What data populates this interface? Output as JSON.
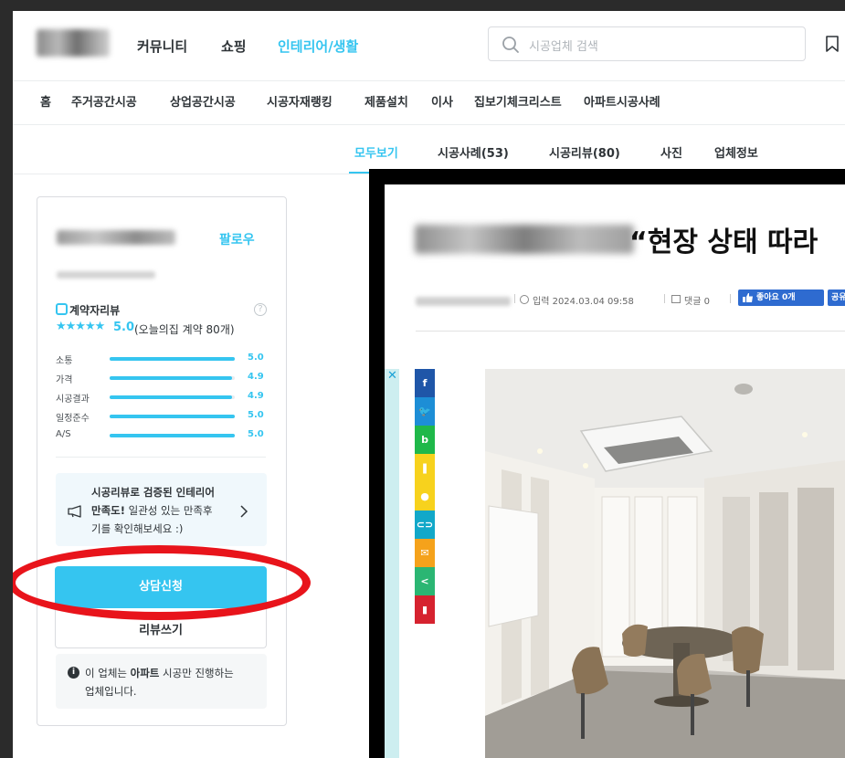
{
  "nav": {
    "items": [
      {
        "label": "커뮤니티",
        "active": false
      },
      {
        "label": "쇼핑",
        "active": false
      },
      {
        "label": "인테리어/생활",
        "active": true
      }
    ],
    "search_placeholder": "시공업체 검색"
  },
  "categories": [
    "홈",
    "주거공간시공",
    "상업공간시공",
    "시공자재랭킹",
    "제품설치",
    "이사",
    "집보기체크리스트",
    "아파트시공사례"
  ],
  "tabs": [
    {
      "label": "모두보기",
      "active": true
    },
    {
      "label": "시공사례(53)",
      "active": false
    },
    {
      "label": "시공리뷰(80)",
      "active": false
    },
    {
      "label": "사진",
      "active": false
    },
    {
      "label": "업체정보",
      "active": false
    }
  ],
  "vendor": {
    "follow_label": "팔로우",
    "review_title": "계약자리뷰",
    "stars": "★★★★★",
    "score": "5.0",
    "score_note": "(오늘의집 계약 80개)",
    "ratings": [
      {
        "label": "소통",
        "value": "5.0",
        "fraction": 1.0
      },
      {
        "label": "가격",
        "value": "4.9",
        "fraction": 0.98
      },
      {
        "label": "시공결과",
        "value": "4.9",
        "fraction": 0.98
      },
      {
        "label": "일정준수",
        "value": "5.0",
        "fraction": 1.0
      },
      {
        "label": "A/S",
        "value": "5.0",
        "fraction": 1.0
      }
    ],
    "promo": {
      "line1": "시공리뷰로 검증된 인테리어",
      "line2_bold": "만족도!",
      "line2_rest": " 일관성 있는 만족후",
      "line3": "기를 확인해보세요 :)"
    },
    "consult_button": "상담신청",
    "review_button": "리뷰쓰기",
    "notice": {
      "prefix": "이 업체는 ",
      "bold": "아파트",
      "suffix": " 시공만 진행하는",
      "line2": "업체입니다."
    }
  },
  "article": {
    "headline": "“현장 상태 따라",
    "date": "입력 2024.03.04 09:58",
    "comments": "댓글 0",
    "like_label": "좋아요 0개",
    "share_label": "공유",
    "share_colors": [
      "#1f56a8",
      "#1d8ed6",
      "#1fb84a",
      "#f7d21d",
      "#f7d21d",
      "#12a8c9",
      "#f5a21b",
      "#2bb673",
      "#d6222f"
    ]
  },
  "annotation_color": "#e8141b",
  "accent_color": "#35c5f0"
}
